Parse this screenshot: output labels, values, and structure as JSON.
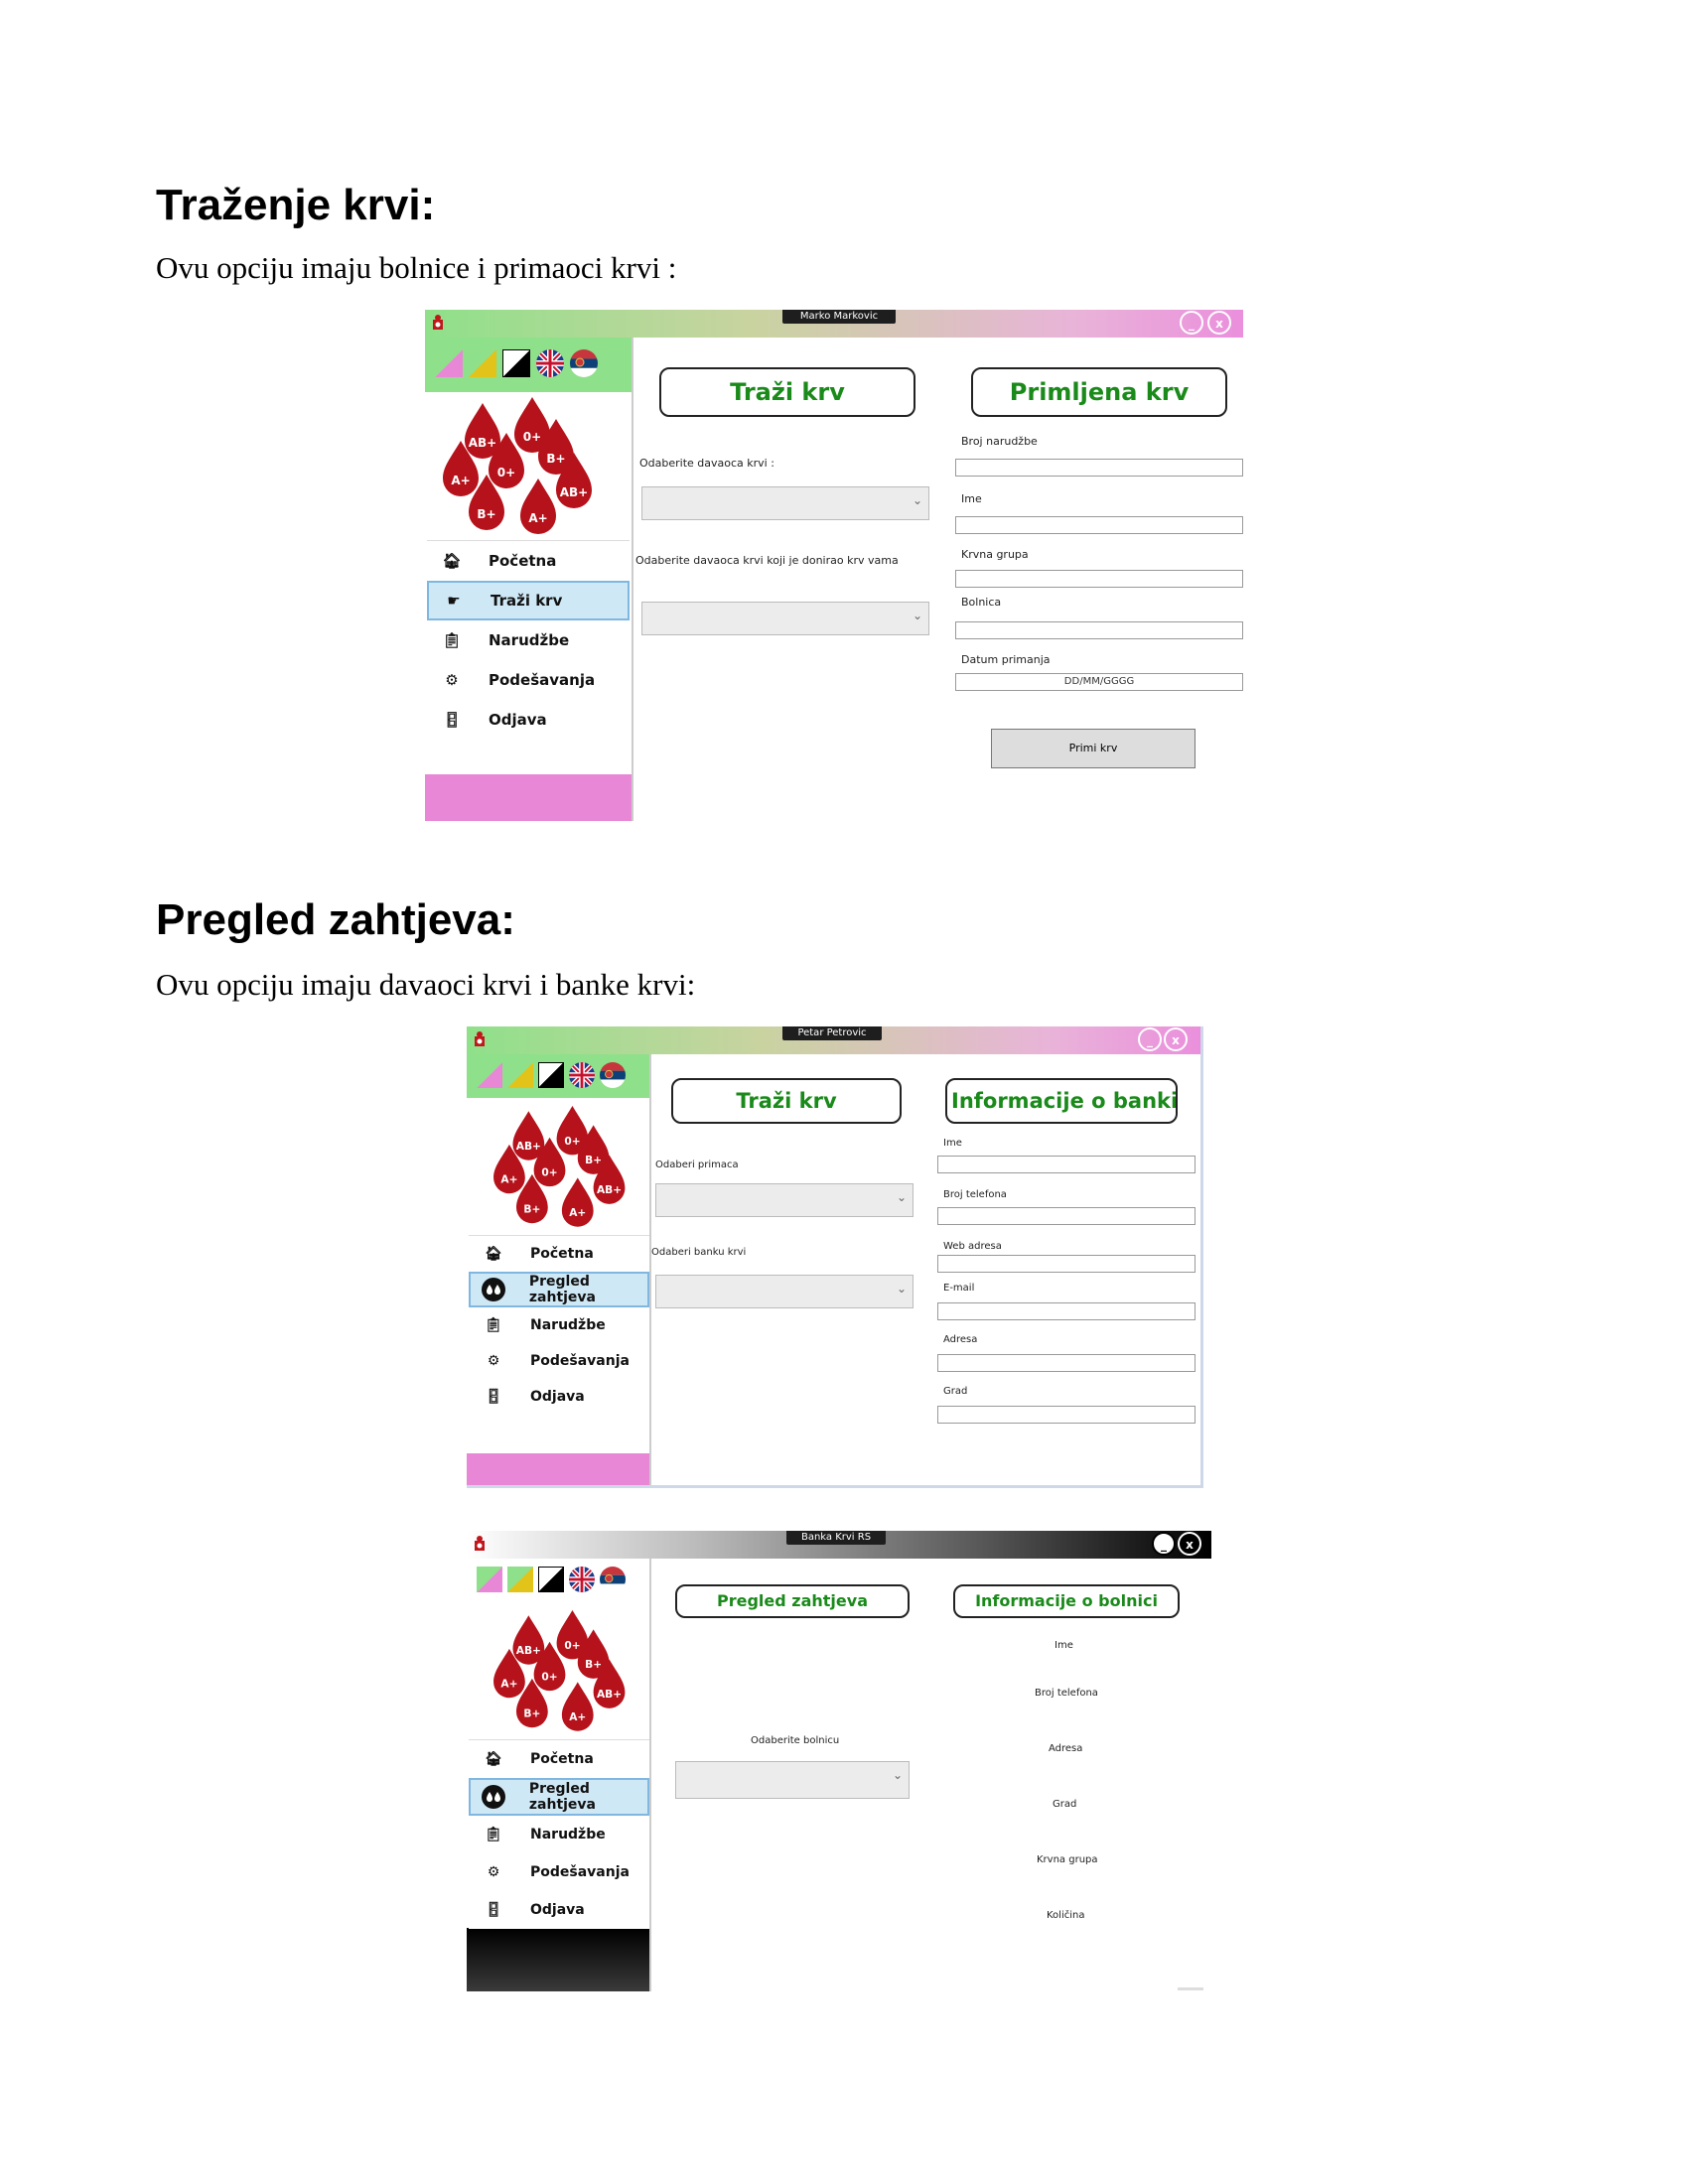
{
  "section1": {
    "heading": "Traženje krvi:",
    "text": "Ovu opciju imaju bolnice i primaoci krvi :",
    "window": {
      "title": "Marko Markovic",
      "min_btn": "_",
      "close_btn": "x",
      "menu": [
        "Početna",
        "Traži krv",
        "Narudžbe",
        "Podešavanja",
        "Odjava"
      ],
      "tab_left": "Traži krv",
      "tab_right": "Primljena krv",
      "label_donor": "Odaberite davaoca krvi :",
      "label_donor2": "Odaberite davaoca krvi koji je donirao krv vama",
      "label_order": "Broj narudžbe",
      "label_name": "Ime",
      "label_blood": "Krvna grupa",
      "label_hospital": "Bolnica",
      "label_date": "Datum primanja",
      "date_placeholder": "DD/MM/GGGG",
      "receive_btn": "Primi krv"
    }
  },
  "section2": {
    "heading": "Pregled zahtjeva:",
    "text": "Ovu opciju imaju davaoci krvi i banke krvi:",
    "window1": {
      "title": "Petar Petrovic",
      "min_btn": "_",
      "close_btn": "x",
      "menu": [
        "Početna",
        "Pregled zahtjeva",
        "Narudžbe",
        "Podešavanja",
        "Odjava"
      ],
      "tab_left": "Traži krv",
      "tab_right": "Informacije o banki l",
      "label_recipient": "Odaberi primaca",
      "label_bank": "Odaberi banku krvi",
      "fields": [
        "Ime",
        "Broj telefona",
        "Web adresa",
        "E-mail",
        "Adresa",
        "Grad"
      ]
    },
    "window2": {
      "title": "Banka Krvi RS",
      "min_btn": "_",
      "close_btn": "x",
      "menu": [
        "Početna",
        "Pregled zahtjeva",
        "Narudžbe",
        "Podešavanja",
        "Odjava"
      ],
      "tab_left": "Pregled zahtjeva",
      "tab_right": "Informacije o bolnici",
      "label_hospital": "Odaberite bolnicu",
      "fields": [
        "Ime",
        "Broj telefona",
        "Adresa",
        "Grad",
        "Krvna grupa",
        "Količina"
      ]
    }
  },
  "colors": {
    "green": "#1a8a1a",
    "pink": "#e887d6",
    "light_green": "#8fe08a",
    "selected": "#cfe8f6"
  },
  "blood_types": [
    "AB+",
    "0+",
    "B+",
    "A+",
    "0+",
    "AB+",
    "B+",
    "A+"
  ]
}
